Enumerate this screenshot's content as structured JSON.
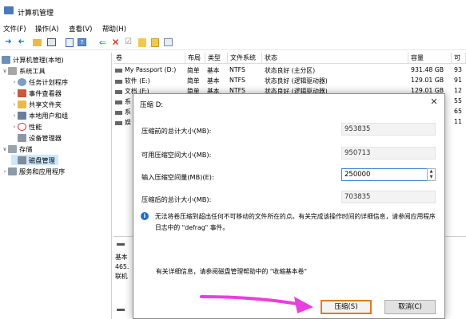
{
  "window": {
    "title": "计算机管理"
  },
  "menu": [
    "文件(F)",
    "操作(A)",
    "查看(V)",
    "帮助(H)"
  ],
  "toolbar": [
    "back-icon",
    "forward-icon",
    "up-folder-icon",
    "show-hide-tree-icon",
    "properties-icon",
    "help-icon",
    "connect-icon",
    "delete-icon",
    "check-icon",
    "open-folder-icon",
    "explore-icon",
    "settings-icon"
  ],
  "tree": [
    {
      "label": "计算机管理(本地)",
      "icon": "computer-icon"
    },
    {
      "label": "系统工具",
      "icon": "tools-icon"
    },
    {
      "label": "任务计划程序",
      "icon": "clock-icon"
    },
    {
      "label": "事件查看器",
      "icon": "event-viewer-icon"
    },
    {
      "label": "共享文件夹",
      "icon": "shared-folder-icon"
    },
    {
      "label": "本地用户和组",
      "icon": "users-icon"
    },
    {
      "label": "性能",
      "icon": "performance-icon"
    },
    {
      "label": "设备管理器",
      "icon": "device-manager-icon"
    },
    {
      "label": "存储",
      "icon": "storage-icon"
    },
    {
      "label": "磁盘管理",
      "icon": "disk-management-icon"
    },
    {
      "label": "服务和应用程序",
      "icon": "services-icon"
    }
  ],
  "columns": [
    "卷",
    "布局",
    "类型",
    "文件系统",
    "状态",
    "容量",
    "可"
  ],
  "volumes": [
    {
      "name": "My Passport (D:)",
      "layout": "简单",
      "type": "基本",
      "fs": "NTFS",
      "status": "状态良好 (主分区)",
      "capacity": "931.48 GB",
      "free": "93"
    },
    {
      "name": "软件 (E:)",
      "layout": "简单",
      "type": "基本",
      "fs": "NTFS",
      "status": "状态良好 (逻辑驱动器)",
      "capacity": "129.01 GB",
      "free": "91"
    },
    {
      "name": "文档 (F:)",
      "layout": "简单",
      "type": "基本",
      "fs": "NTFS",
      "status": "状态良好 (逻辑驱动器)",
      "capacity": "129.01 GB",
      "free": "12"
    },
    {
      "name": "系",
      "layout": "",
      "type": "",
      "fs": "",
      "status": "",
      "capacity": "",
      "free": "55"
    },
    {
      "name": "系",
      "layout": "",
      "type": "",
      "fs": "",
      "status": "",
      "capacity": "",
      "free": "65"
    },
    {
      "name": "娱",
      "layout": "",
      "type": "",
      "fs": "",
      "status": "",
      "capacity": "",
      "free": "11"
    }
  ],
  "disk_area": {
    "lines": [
      "基本",
      "465.",
      "联机"
    ]
  },
  "dialog": {
    "title": "压缩 D:",
    "close": "✕",
    "fields": [
      {
        "label": "压缩前的总计大小(MB):",
        "value": "953835"
      },
      {
        "label": "可用压缩空间大小(MB):",
        "value": "950713"
      },
      {
        "label": "输入压缩空间量(MB)(E):",
        "value": "250000"
      },
      {
        "label": "压缩后的总计大小(MB):",
        "value": "703835"
      }
    ],
    "info": "无法将卷压缩到超出任何不可移动的文件所在的点。有关完成该操作时间的详细信息，请参阅应用程序日志中的 \"defrag\" 事件。",
    "help": "有关详细信息，请参阅磁盘管理帮助中的 \"收缩基本卷\"",
    "shrink_button": "压缩(S)",
    "cancel_button": "取消(C)"
  },
  "colors": {
    "accent": "#0078d7",
    "highlight_border": "#e07b1a",
    "annotation_arrow": "#e83fe0"
  }
}
